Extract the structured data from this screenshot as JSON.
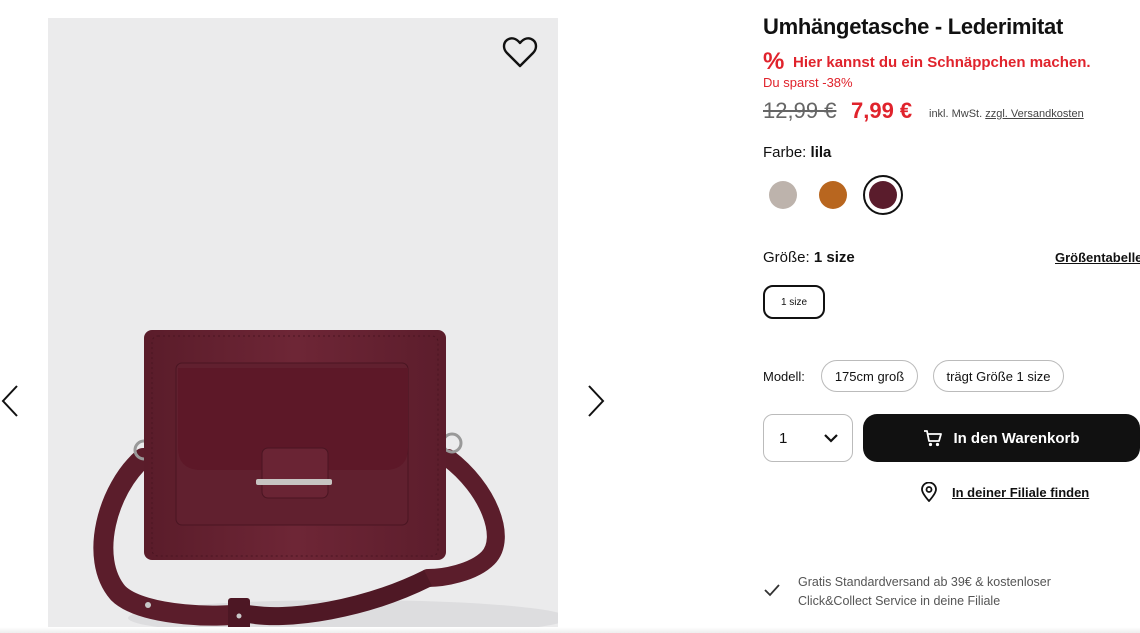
{
  "product": {
    "title": "Umhängetasche - Lederimitat",
    "deal_icon": "%",
    "deal_text": "Hier kannst du ein Schnäppchen machen.",
    "savings": "Du sparst -38%",
    "old_price": "12,99 €",
    "new_price": "7,99 €",
    "tax_note": "inkl. MwSt.",
    "shipping_costs_link": "zzgl. Versandkosten"
  },
  "color": {
    "label": "Farbe:",
    "selected": "lila",
    "swatches": [
      {
        "name": "taupe",
        "hex": "#bdb3ac"
      },
      {
        "name": "cognac",
        "hex": "#b8661f"
      },
      {
        "name": "lila",
        "hex": "#5a1c2c"
      }
    ]
  },
  "size": {
    "label": "Größe:",
    "selected": "1 size",
    "size_table_link": "Größentabelle",
    "options": [
      "1 size"
    ]
  },
  "model": {
    "label": "Modell:",
    "height": "175cm groß",
    "wears": "trägt Größe 1 size"
  },
  "purchase": {
    "quantity": "1",
    "add_to_cart": "In den Warenkorb",
    "find_in_store": "In deiner Filiale finden"
  },
  "shipping_info": "Gratis Standardversand ab 39€ & kostenloser Click&Collect Service in deine Filiale",
  "icons": {
    "favorite": "heart-icon",
    "prev": "chevron-left-icon",
    "next": "chevron-right-icon",
    "quantity": "chevron-down-icon",
    "cart": "cart-icon",
    "store": "location-pin-icon",
    "shipping": "check-icon"
  },
  "colors": {
    "accent_red": "#e0232c",
    "button_black": "#111111",
    "product_bg": "#ebebec"
  }
}
